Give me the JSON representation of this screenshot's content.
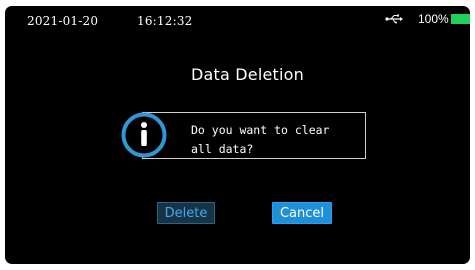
{
  "status_bar": {
    "date": "2021-01-20",
    "time": "16:12:32",
    "usb_icon": "usb-icon",
    "battery_percent": "100%",
    "battery_level": 1.0,
    "battery_color": "#1fd15a"
  },
  "dialog": {
    "title": "Data Deletion",
    "message": "Do you want to clear\nall data?",
    "icon": "info-icon",
    "icon_color": "#2f97d6",
    "buttons": {
      "delete_label": "Delete",
      "cancel_label": "Cancel"
    }
  },
  "colors": {
    "background": "#000000",
    "accent": "#1f8fd8",
    "delete_text": "#42a8ea"
  }
}
